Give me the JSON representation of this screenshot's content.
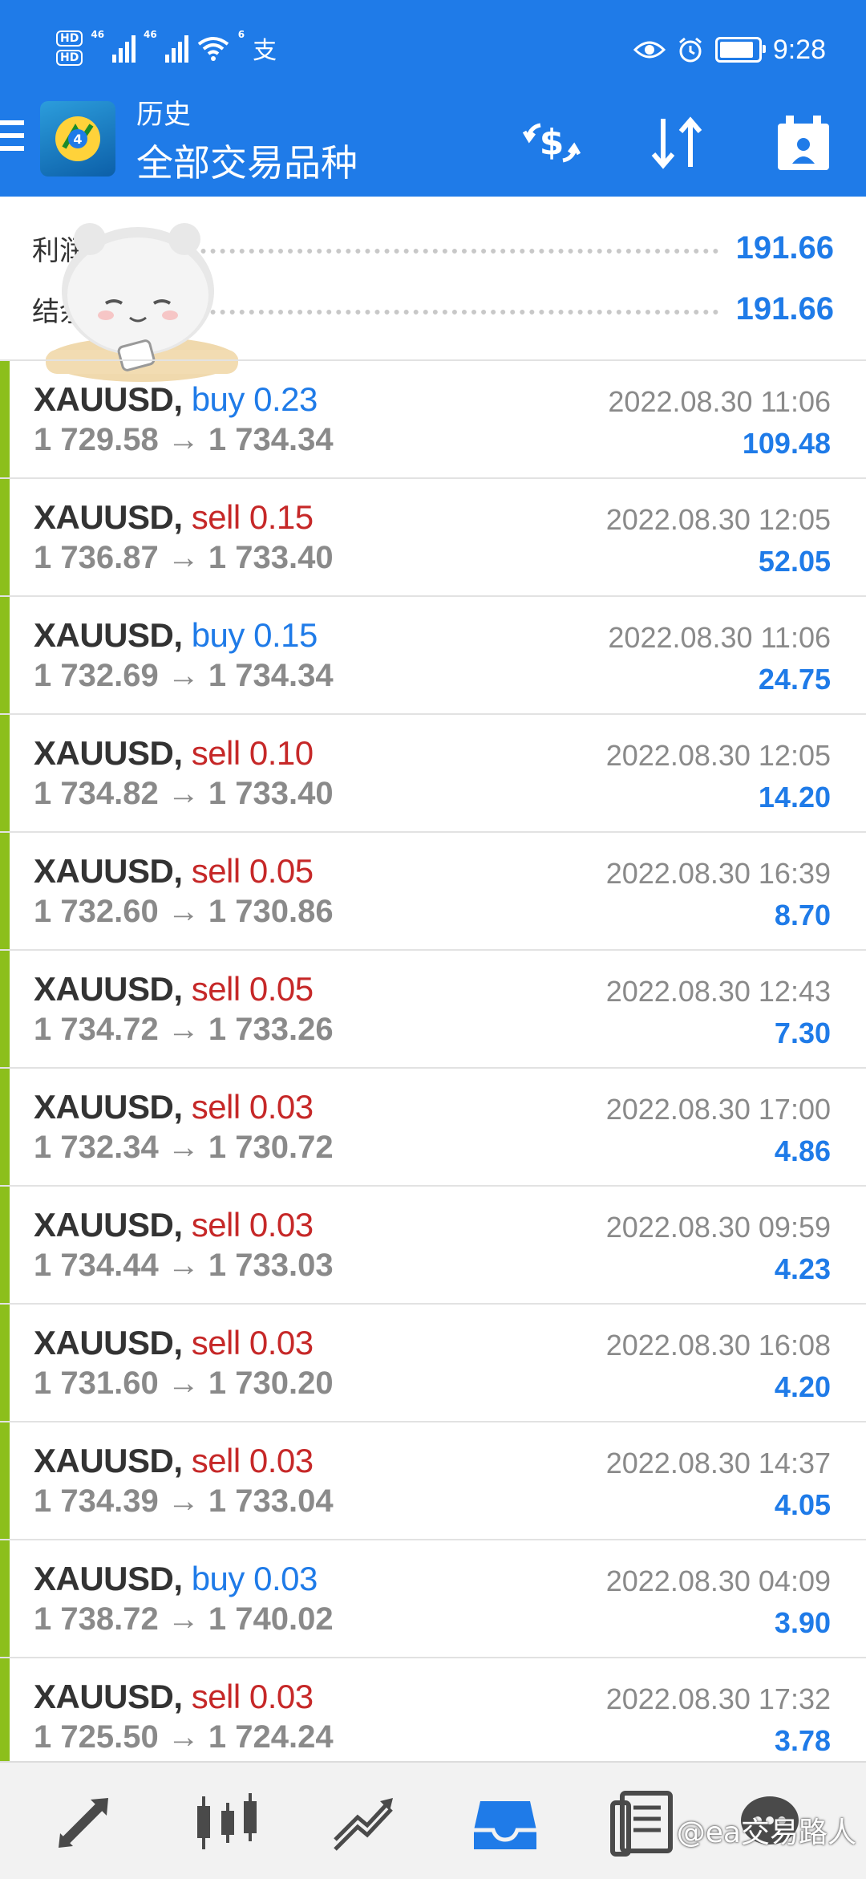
{
  "status_bar": {
    "hd_1": "HD",
    "hd_2": "HD",
    "gen_1": "46",
    "gen_2": "46",
    "wifi_gen": "6",
    "app_glyph": "支",
    "time": "9:28",
    "icons": [
      "eye-icon",
      "alarm-icon",
      "battery-icon"
    ]
  },
  "header": {
    "title": "历史",
    "subtitle": "全部交易品种",
    "icons": [
      "currency-exchange-icon",
      "sort-icon",
      "calendar-icon"
    ]
  },
  "summary": {
    "profit_label": "利润",
    "profit_value": "191.66",
    "balance_label": "结余",
    "balance_value": "191.66"
  },
  "trades": [
    {
      "symbol": "XAUUSD,",
      "type": "buy",
      "volume": "0.23",
      "prices": "1 729.58 → 1 734.34",
      "time": "2022.08.30 11:06",
      "profit": "109.48"
    },
    {
      "symbol": "XAUUSD,",
      "type": "sell",
      "volume": "0.15",
      "prices": "1 736.87 → 1 733.40",
      "time": "2022.08.30 12:05",
      "profit": "52.05"
    },
    {
      "symbol": "XAUUSD,",
      "type": "buy",
      "volume": "0.15",
      "prices": "1 732.69 → 1 734.34",
      "time": "2022.08.30 11:06",
      "profit": "24.75"
    },
    {
      "symbol": "XAUUSD,",
      "type": "sell",
      "volume": "0.10",
      "prices": "1 734.82 → 1 733.40",
      "time": "2022.08.30 12:05",
      "profit": "14.20"
    },
    {
      "symbol": "XAUUSD,",
      "type": "sell",
      "volume": "0.05",
      "prices": "1 732.60 → 1 730.86",
      "time": "2022.08.30 16:39",
      "profit": "8.70"
    },
    {
      "symbol": "XAUUSD,",
      "type": "sell",
      "volume": "0.05",
      "prices": "1 734.72 → 1 733.26",
      "time": "2022.08.30 12:43",
      "profit": "7.30"
    },
    {
      "symbol": "XAUUSD,",
      "type": "sell",
      "volume": "0.03",
      "prices": "1 732.34 → 1 730.72",
      "time": "2022.08.30 17:00",
      "profit": "4.86"
    },
    {
      "symbol": "XAUUSD,",
      "type": "sell",
      "volume": "0.03",
      "prices": "1 734.44 → 1 733.03",
      "time": "2022.08.30 09:59",
      "profit": "4.23"
    },
    {
      "symbol": "XAUUSD,",
      "type": "sell",
      "volume": "0.03",
      "prices": "1 731.60 → 1 730.20",
      "time": "2022.08.30 16:08",
      "profit": "4.20"
    },
    {
      "symbol": "XAUUSD,",
      "type": "sell",
      "volume": "0.03",
      "prices": "1 734.39 → 1 733.04",
      "time": "2022.08.30 14:37",
      "profit": "4.05"
    },
    {
      "symbol": "XAUUSD,",
      "type": "buy",
      "volume": "0.03",
      "prices": "1 738.72 → 1 740.02",
      "time": "2022.08.30 04:09",
      "profit": "3.90"
    },
    {
      "symbol": "XAUUSD,",
      "type": "sell",
      "volume": "0.03",
      "prices": "1 725.50 → 1 724.24",
      "time": "2022.08.30 17:32",
      "profit": "3.78"
    }
  ],
  "bottom_nav": {
    "items": [
      "quotes-icon",
      "chart-icon",
      "trade-icon",
      "history-icon",
      "news-icon",
      "chat-icon"
    ],
    "active": "history-icon"
  },
  "watermark": "@ea交易路人",
  "colors": {
    "accent_blue": "#1f7be8",
    "sell_red": "#c62828",
    "row_bar_green": "#8cbf1c",
    "muted_gray": "#8a8a8a"
  }
}
